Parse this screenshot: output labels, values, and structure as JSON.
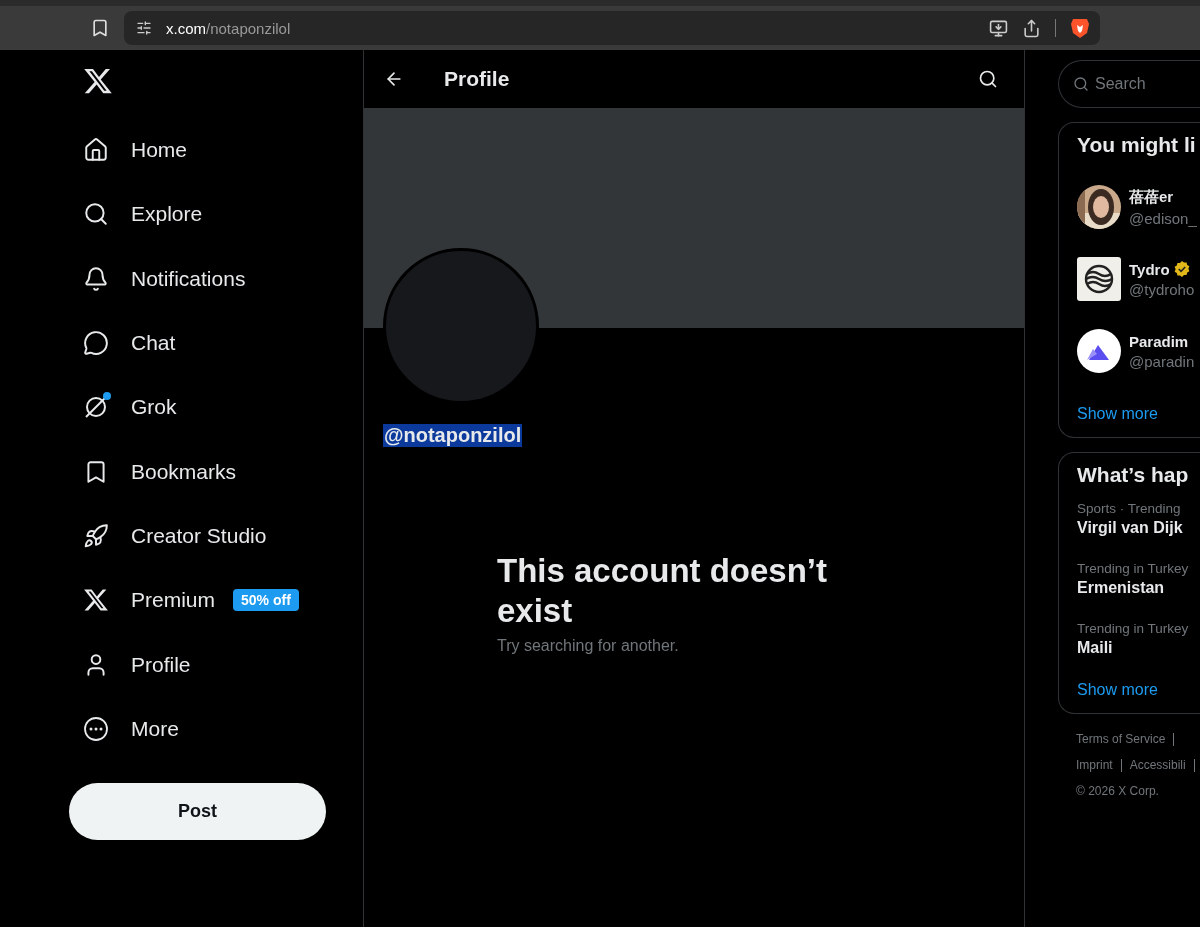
{
  "browser": {
    "url_host": "x.com",
    "url_path": "/notaponzilol"
  },
  "nav": [
    {
      "label": "Home"
    },
    {
      "label": "Explore"
    },
    {
      "label": "Notifications"
    },
    {
      "label": "Chat"
    },
    {
      "label": "Grok",
      "dot": true
    },
    {
      "label": "Bookmarks"
    },
    {
      "label": "Creator Studio"
    },
    {
      "label": "Premium",
      "badge": "50% off"
    },
    {
      "label": "Profile"
    },
    {
      "label": "More"
    }
  ],
  "post_button": "Post",
  "header": {
    "title": "Profile"
  },
  "profile": {
    "handle": "@notaponzilol",
    "handle_highlighted": true,
    "message_title": "This account doesn’t exist",
    "message_body": "Try searching for another."
  },
  "search": {
    "placeholder": "Search"
  },
  "suggestions": {
    "title": "You might li",
    "accounts": [
      {
        "name": "蓓蓓er",
        "handle": "@edison_",
        "verified": false
      },
      {
        "name": "Tydro",
        "handle": "@tydroho",
        "verified": true
      },
      {
        "name": "Paradim",
        "handle": "@paradin",
        "verified": false
      }
    ],
    "show_more": "Show more"
  },
  "trends": {
    "title": "What’s hap",
    "items": [
      {
        "context": "Sports · Trending",
        "topic": "Virgil van Dijk"
      },
      {
        "context": "Trending in Turkey",
        "topic": "Ermenistan"
      },
      {
        "context": "Trending in Turkey",
        "topic": "Maili"
      }
    ],
    "show_more": "Show more"
  },
  "footer": {
    "lines": [
      {
        "links": [
          "Terms of Service"
        ]
      },
      {
        "links": [
          "Imprint",
          "Accessibili"
        ]
      }
    ],
    "copyright": "© 2026 X Corp."
  }
}
